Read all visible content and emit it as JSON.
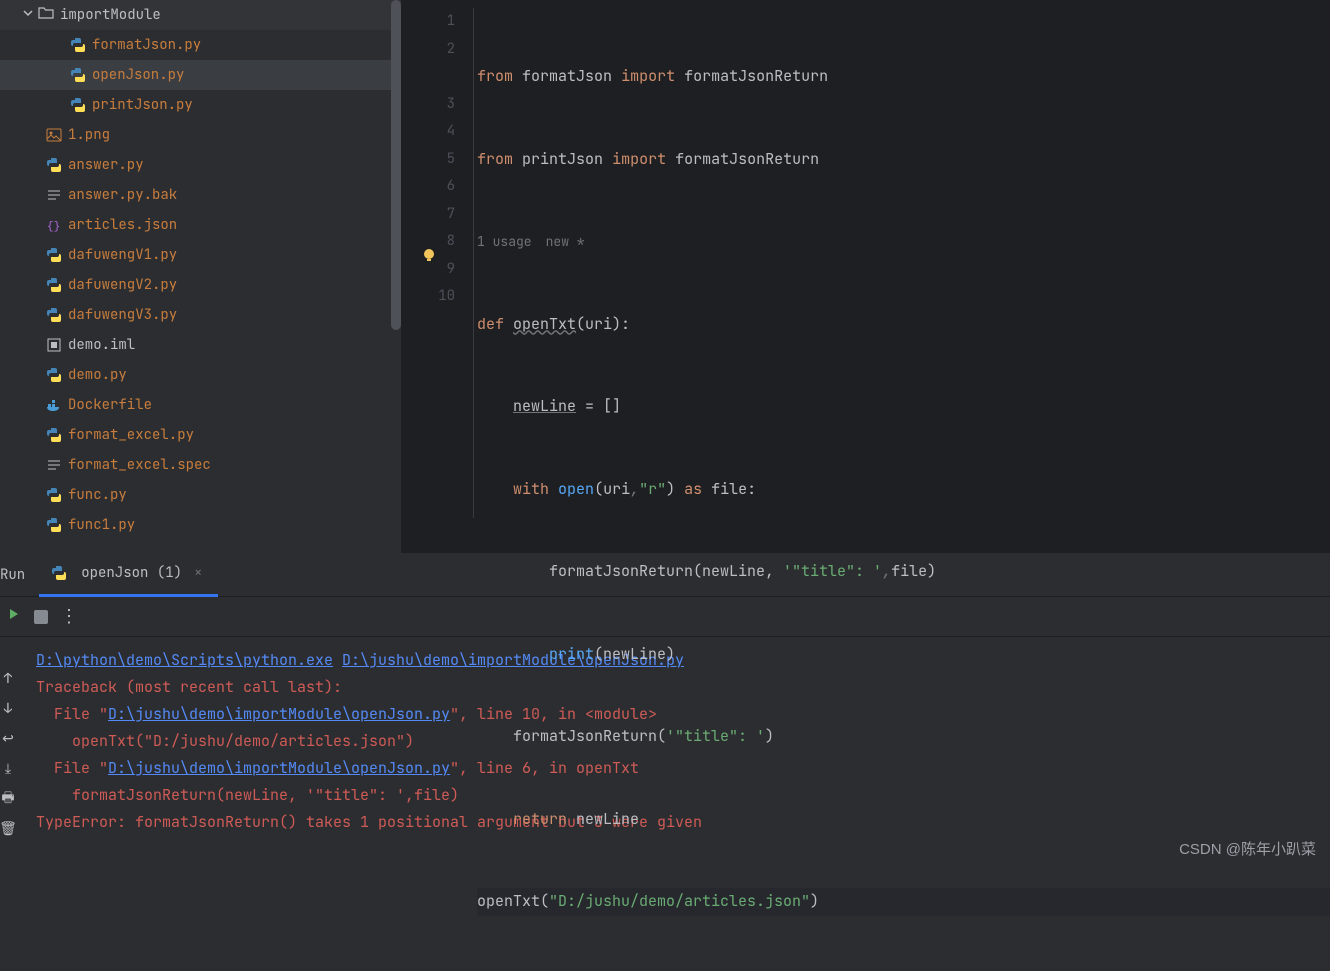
{
  "sidebar": {
    "folder": "importModule",
    "nested": [
      {
        "label": "formatJson.py",
        "orange": true,
        "icon": "py"
      },
      {
        "label": "openJson.py",
        "orange": true,
        "icon": "py",
        "selected": true
      },
      {
        "label": "printJson.py",
        "orange": true,
        "icon": "py"
      }
    ],
    "files": [
      {
        "label": "1.png",
        "orange": true,
        "icon": "img"
      },
      {
        "label": "answer.py",
        "orange": true,
        "icon": "py"
      },
      {
        "label": "answer.py.bak",
        "orange": true,
        "icon": "txt"
      },
      {
        "label": "articles.json",
        "orange": true,
        "icon": "json"
      },
      {
        "label": "dafuwengV1.py",
        "orange": true,
        "icon": "py"
      },
      {
        "label": "dafuwengV2.py",
        "orange": true,
        "icon": "py"
      },
      {
        "label": "dafuwengV3.py",
        "orange": true,
        "icon": "py"
      },
      {
        "label": "demo.iml",
        "orange": false,
        "icon": "iml"
      },
      {
        "label": "demo.py",
        "orange": true,
        "icon": "py"
      },
      {
        "label": "Dockerfile",
        "orange": true,
        "icon": "docker"
      },
      {
        "label": "format_excel.py",
        "orange": true,
        "icon": "py"
      },
      {
        "label": "format_excel.spec",
        "orange": true,
        "icon": "txt"
      },
      {
        "label": "func.py",
        "orange": true,
        "icon": "py"
      },
      {
        "label": "func1.py",
        "orange": true,
        "icon": "py"
      }
    ]
  },
  "editor": {
    "hints": {
      "usages": "1 usage",
      "newstar": "new *"
    },
    "lines": [
      "1",
      "2",
      "3",
      "4",
      "5",
      "6",
      "7",
      "8",
      "9",
      "10"
    ],
    "code": {
      "l1": {
        "from": "from",
        "mod": "formatJson",
        "imp": "import",
        "name": "formatJsonReturn"
      },
      "l2": {
        "from": "from",
        "mod": "printJson",
        "imp": "import",
        "name": "formatJsonReturn"
      },
      "l3": {
        "def": "def",
        "name": "openTxt",
        "params": "(uri):"
      },
      "l4": {
        "var": "newLine",
        "rest": " = []"
      },
      "l5": {
        "with": "with",
        "open": "open",
        "p1": "(uri",
        "comma": ",",
        "str": "\"r\"",
        "p2": ")",
        "as": "as",
        "file": "file:"
      },
      "l6": {
        "fn": "formatJsonReturn",
        "p": "(newLine, ",
        "str": "'\"title\": '",
        "comma": ",",
        "rest": "file)"
      },
      "l7": {
        "print": "print",
        "rest": "(newLine)"
      },
      "l8": {
        "fn": "formatJsonReturn(",
        "str": "'\"title\": '",
        "rest": ")"
      },
      "l9": {
        "ret": "return",
        "var": "newLine"
      },
      "l10": {
        "fn": "openTxt(",
        "str": "\"D:/jushu/demo/articles.json\"",
        "rest": ")"
      }
    }
  },
  "run": {
    "label": "Run",
    "tab": "openJson (1)"
  },
  "console": {
    "path1": "D:\\python\\demo\\Scripts\\python.exe",
    "path2": "D:\\jushu\\demo\\importModule\\openJson.py",
    "trace": "Traceback (most recent call last):",
    "file1a": "  File \"",
    "file1link": "D:\\jushu\\demo\\importModule\\openJson.py",
    "file1b": "\", line 10, in <module>",
    "line1": "    openTxt(\"D:/jushu/demo/articles.json\")",
    "file2a": "  File \"",
    "file2link": "D:\\jushu\\demo\\importModule\\openJson.py",
    "file2b": "\", line 6, in openTxt",
    "line2": "    formatJsonReturn(newLine, '\"title\": ',file)",
    "error": "TypeError: formatJsonReturn() takes 1 positional argument but 3 were given"
  },
  "watermark": "CSDN @陈年小趴菜"
}
